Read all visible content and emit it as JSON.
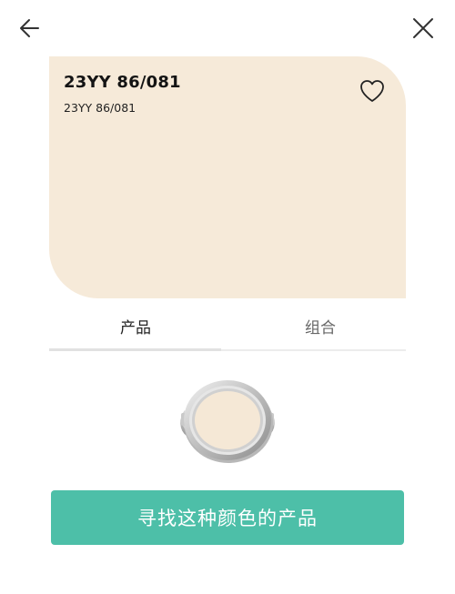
{
  "header": {
    "back_icon": "arrow-left-icon",
    "close_icon": "close-icon"
  },
  "swatch": {
    "name": "23YY 86/081",
    "code": "23YY 86/081",
    "color": "#F6EAD9",
    "favorite_icon": "heart-outline-icon"
  },
  "tabs": [
    {
      "label": "产品",
      "active": true
    },
    {
      "label": "组合",
      "active": false
    }
  ],
  "product": {
    "image": "paint-can-icon",
    "paint_color": "#F5E8D6"
  },
  "cta": {
    "label": "寻找这种颜色的产品",
    "color": "#4DBFA8"
  }
}
